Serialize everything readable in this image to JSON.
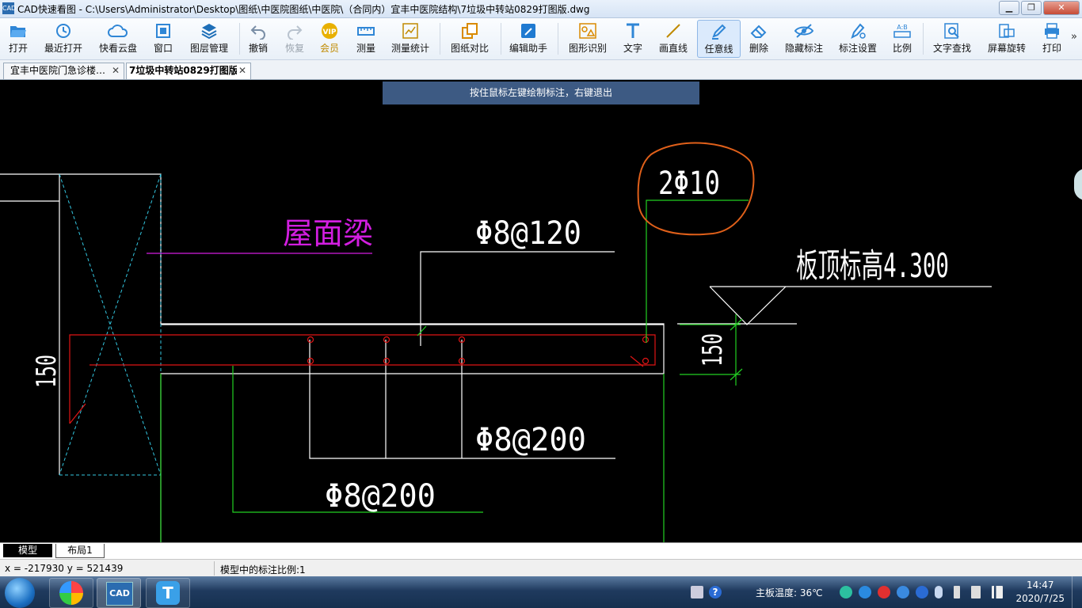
{
  "window": {
    "title": "CAD快速看图 - C:\\Users\\Administrator\\Desktop\\图纸\\中医院图纸\\中医院\\（合同内）宜丰中医院结构\\7垃圾中转站0829打图版.dwg",
    "icon_text": "CAD",
    "min_icon": "minimize-icon",
    "max_icon": "maximize-icon",
    "close_icon": "close-icon",
    "min_glyph": "▁",
    "max_glyph": "❐",
    "close_glyph": "✕"
  },
  "toolbar": {
    "items": [
      {
        "label": "打开",
        "icon": "folder-open-icon"
      },
      {
        "label": "最近打开",
        "icon": "recent-clock-icon"
      },
      {
        "label": "快看云盘",
        "icon": "cloud-icon"
      },
      {
        "label": "窗口",
        "icon": "window-icon"
      },
      {
        "label": "图层管理",
        "icon": "layers-icon"
      },
      {
        "label": "撤销",
        "icon": "undo-icon"
      },
      {
        "label": "恢复",
        "icon": "redo-icon"
      },
      {
        "label": "会员",
        "icon": "vip-icon"
      },
      {
        "label": "测量",
        "icon": "ruler-icon"
      },
      {
        "label": "测量统计",
        "icon": "measure-stats-icon"
      },
      {
        "label": "图纸对比",
        "icon": "compare-icon"
      },
      {
        "label": "编辑助手",
        "icon": "cad-edit-icon"
      },
      {
        "label": "图形识别",
        "icon": "shape-recognize-icon"
      },
      {
        "label": "文字",
        "icon": "text-t-icon"
      },
      {
        "label": "画直线",
        "icon": "line-icon"
      },
      {
        "label": "任意线",
        "icon": "pencil-icon"
      },
      {
        "label": "删除",
        "icon": "eraser-icon"
      },
      {
        "label": "隐藏标注",
        "icon": "eye-hide-icon"
      },
      {
        "label": "标注设置",
        "icon": "annotation-settings-icon"
      },
      {
        "label": "比例",
        "icon": "scale-icon"
      },
      {
        "label": "文字查找",
        "icon": "text-search-icon"
      },
      {
        "label": "屏幕旋转",
        "icon": "screen-rotate-icon"
      },
      {
        "label": "打印",
        "icon": "printer-icon"
      }
    ],
    "overflow": "»",
    "vip_text": "VIP"
  },
  "tabs": [
    {
      "label": "宜丰中医院门急诊楼…",
      "close": "✕"
    },
    {
      "label": "7垃圾中转站0829打图版",
      "close": "✕"
    }
  ],
  "canvas": {
    "hint": "按住鼠标左键绘制标注，右键退出",
    "labels": {
      "roof_beam": "屋面梁",
      "stirrup_120": "Φ8@120",
      "rebar_2phi10": "2Φ10",
      "slab_top": "板顶标高4.300",
      "stirrup_200_right": "Φ8@200",
      "stirrup_200_bottom": "Φ8@200",
      "dim_150_left": "150",
      "dim_150_right": "150"
    },
    "colors": {
      "background": "#000000",
      "outline": "#ffffff",
      "cyan_dash": "#33c6e0",
      "rebar": "#e01515",
      "magenta": "#d21ee0",
      "green": "#22d022",
      "markup": "#e0601a"
    }
  },
  "layout_tabs": [
    {
      "label": "模型"
    },
    {
      "label": "布局1"
    }
  ],
  "status": {
    "coords": "x = -217930 y = 521439",
    "scale_text": "模型中的标注比例:1"
  },
  "taskbar": {
    "temperature": "主板温度: 36℃",
    "time": "14:47",
    "date": "2020/7/25",
    "cad_text": "CAD",
    "t_text": "T",
    "help_text": "?",
    "apps": [
      "windows-start-icon",
      "browser-icon",
      "cad-app-icon",
      "t-app-icon"
    ]
  }
}
